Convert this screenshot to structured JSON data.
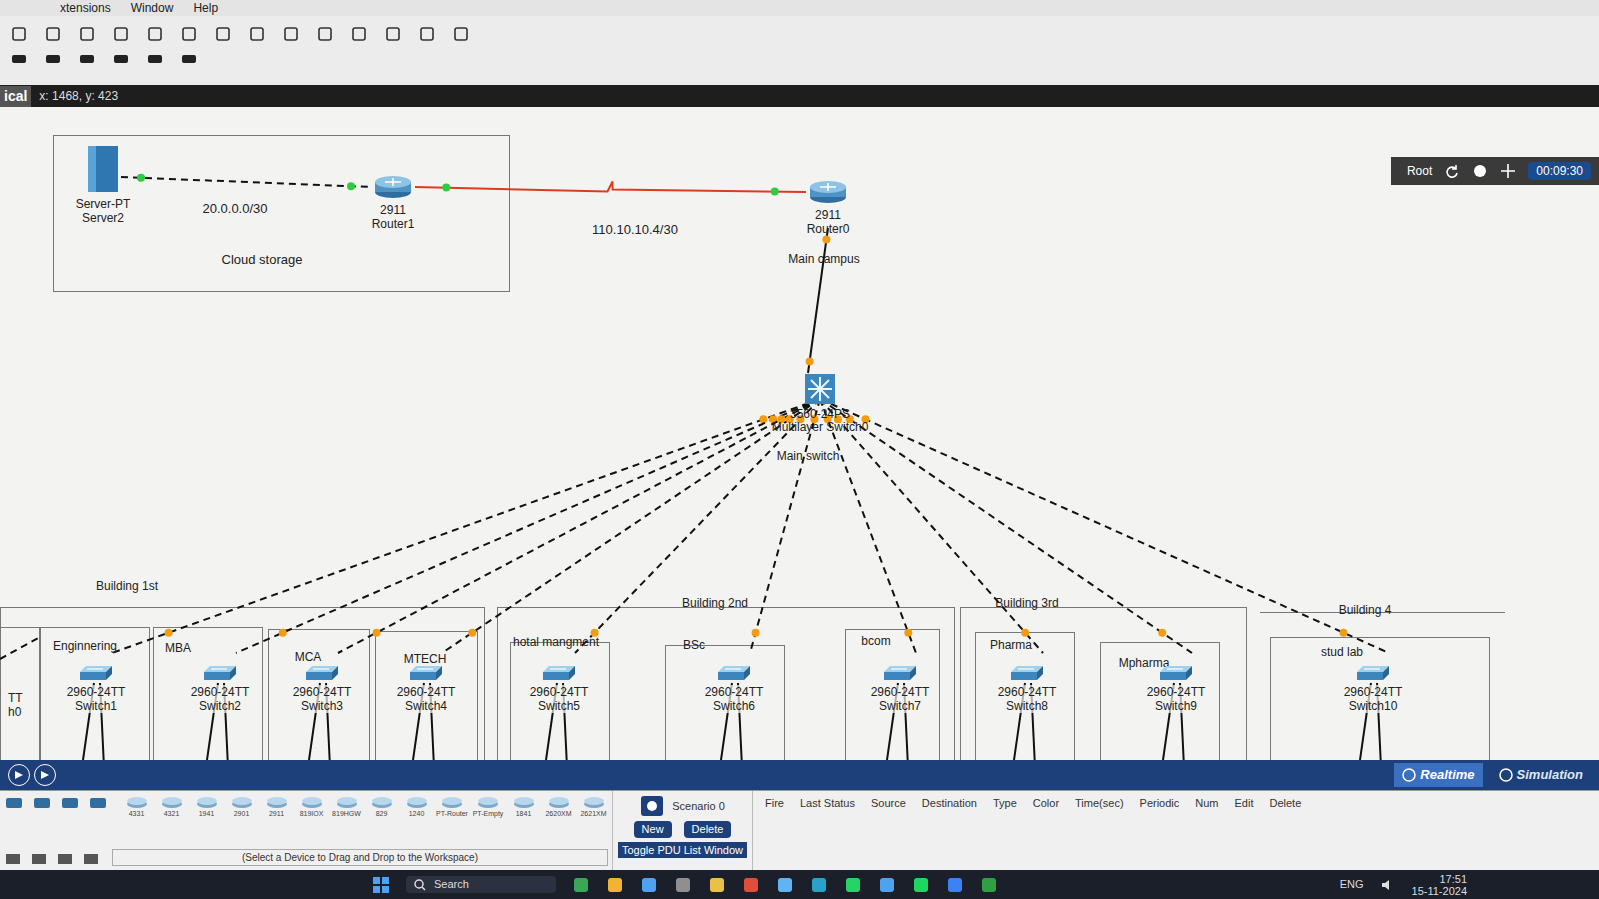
{
  "menu": [
    "xtensions",
    "Window",
    "Help"
  ],
  "canvas_bar": {
    "view": "ical",
    "coords": "x: 1468, y: 423"
  },
  "root_bar": {
    "label": "Root",
    "time": "00:09:30"
  },
  "cloud": {
    "label": "Cloud storage"
  },
  "server": {
    "model": "Server-PT",
    "name": "Server2"
  },
  "routers": [
    {
      "model": "2911",
      "name": "Router1"
    },
    {
      "model": "2911",
      "name": "Router0",
      "label": "Main campus"
    }
  ],
  "networks": [
    "20.0.0.0/30",
    "110.10.10.4/30"
  ],
  "links": {
    "server_router1": {
      "kind": "cross",
      "light": "#2ecc40"
    },
    "router1_router0": {
      "kind": "serial",
      "light": "#2ecc40"
    },
    "router0_core": {
      "kind": "straight",
      "light": "#f39c12"
    }
  },
  "core": {
    "model": "3560-24PS",
    "name": "Multilayer Switch0",
    "label": "Main switch"
  },
  "buildings": [
    "Building 1st",
    "Building 2nd",
    "Building 3rd",
    "Building 4"
  ],
  "partial_switch": {
    "model": "TT",
    "name": "h0"
  },
  "switches": [
    {
      "dept": "Enginnering",
      "model": "2960-24TT",
      "name": "Switch1",
      "uplink": {
        "kind": "cross",
        "light": "#f39c12"
      }
    },
    {
      "dept": "MBA",
      "model": "2960-24TT",
      "name": "Switch2",
      "uplink": {
        "kind": "cross",
        "light": "#f39c12"
      }
    },
    {
      "dept": "MCA",
      "model": "2960-24TT",
      "name": "Switch3",
      "uplink": {
        "kind": "cross",
        "light": "#f39c12"
      }
    },
    {
      "dept": "MTECH",
      "model": "2960-24TT",
      "name": "Switch4",
      "uplink": {
        "kind": "cross",
        "light": "#f39c12"
      }
    },
    {
      "dept": "hotal mangment",
      "model": "2960-24TT",
      "name": "Switch5",
      "uplink": {
        "kind": "cross",
        "light": "#f39c12"
      }
    },
    {
      "dept": "BSc",
      "model": "2960-24TT",
      "name": "Switch6",
      "uplink": {
        "kind": "cross",
        "light": "#f39c12"
      }
    },
    {
      "dept": "bcom",
      "model": "2960-24TT",
      "name": "Switch7",
      "uplink": {
        "kind": "cross",
        "light": "#f39c12"
      }
    },
    {
      "dept": "Pharma",
      "model": "2960-24TT",
      "name": "Switch8",
      "uplink": {
        "kind": "cross",
        "light": "#f39c12"
      }
    },
    {
      "dept": "Mpharma",
      "model": "2960-24TT",
      "name": "Switch9",
      "uplink": {
        "kind": "cross",
        "light": "#f39c12"
      }
    },
    {
      "dept": "stud lab",
      "model": "2960-24TT",
      "name": "Switch10",
      "uplink": {
        "kind": "cross",
        "light": "#f39c12"
      }
    }
  ],
  "mode_tabs": [
    {
      "label": "Realtime",
      "selected": true
    },
    {
      "label": "Simulation",
      "selected": false
    }
  ],
  "devices": [
    "4331",
    "4321",
    "1941",
    "2901",
    "2911",
    "819IOX",
    "819HGW",
    "829",
    "1240",
    "PT-Router",
    "PT-Empty",
    "1841",
    "2620XM",
    "2621XM"
  ],
  "device_hint": "(Select a Device to Drag and Drop to the Workspace)",
  "scenario": "Scenario 0",
  "scenario_buttons": [
    "New",
    "Delete"
  ],
  "toggle": "Toggle PDU List Window",
  "pdu_columns": [
    "Fire",
    "Last Status",
    "Source",
    "Destination",
    "Type",
    "Color",
    "Time(sec)",
    "Periodic",
    "Num",
    "Edit",
    "Delete"
  ],
  "taskbar": {
    "search": "Search",
    "lang": "ENG",
    "time": "17:51",
    "date": "15-11-2024"
  }
}
